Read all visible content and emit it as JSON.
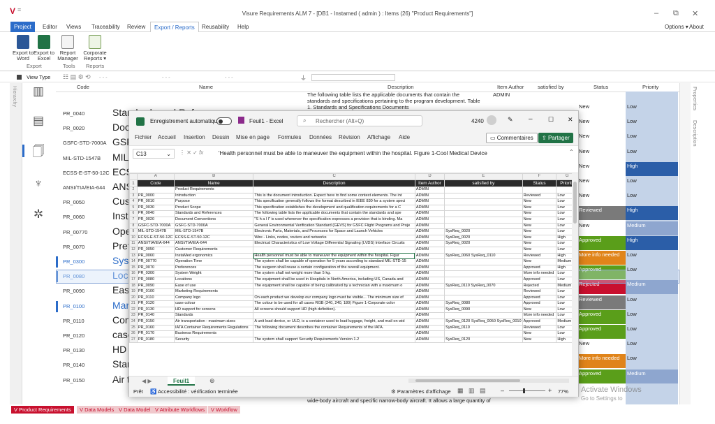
{
  "app": {
    "logo": "V",
    "title": "Visure Requirements ALM 7 - [DB1 - Instamed ( admin ) : Items (26) \"Product Requirements\"]",
    "options": "Options ▾",
    "about": "About"
  },
  "menu": [
    "Project",
    "Editor",
    "Views",
    "Traceability",
    "Review",
    "Export / Reports",
    "Reusability",
    "Help"
  ],
  "ribbon": {
    "export_word": "Export to Word",
    "export_excel": "Export to Excel",
    "report_manager": "Report Manager",
    "corporate_reports": "Corporate Reports ▾",
    "group_export": "Export",
    "group_tools": "Tools",
    "group_reports": "Reports"
  },
  "toolbar2": {
    "view_type": "View Type",
    "dash": "- - -"
  },
  "grid": {
    "headers": {
      "code": "Code",
      "name": "Name",
      "description": "Description",
      "author": "Item Author",
      "satisfied": "satisfied by",
      "status": "Status",
      "priority": "Priority"
    },
    "top_desc": "The following table lists the applicable documents that contain the standards and specifications pertaining to the program development. Table 1. Standards and Specifications Documents",
    "top_author": "ADMIN",
    "bottom_desc": "wide-body aircraft and specific narrow-body aircraft. It allows a large quantity of",
    "rows": [
      {
        "code": "PR_0040",
        "name": "Standards and References",
        "status": "New",
        "priority": "Low",
        "blue": false
      },
      {
        "code": "PR_0020",
        "name": "Doc",
        "status": "New",
        "priority": "Low",
        "blue": false
      },
      {
        "code": "GSFC-STD-7000A",
        "name": "GSFC",
        "status": "New",
        "priority": "Low",
        "blue": false
      },
      {
        "code": "MIL-STD-1547B",
        "name": "MIL-",
        "status": "New",
        "priority": "Low",
        "blue": false
      },
      {
        "code": "ECSS-E-ST-50-12C",
        "name": "ECSS",
        "status": "New",
        "priority": "High",
        "blue": false
      },
      {
        "code": "ANSI/TIA/EIA-644",
        "name": "ANS",
        "status": "New",
        "priority": "Low",
        "blue": false
      },
      {
        "code": "PR_0050",
        "name": "Cus",
        "status": "New",
        "priority": "Low",
        "blue": false
      },
      {
        "code": "PR_0060",
        "name": "Inst",
        "status": "Reviewed",
        "priority": "High",
        "blue": false
      },
      {
        "code": "PR_00770",
        "name": "Ope",
        "status": "New",
        "priority": "Medium",
        "blue": false
      },
      {
        "code": "PR_0070",
        "name": "Pref",
        "status": "Approved",
        "priority": "High",
        "blue": false
      },
      {
        "code": "PR_0300",
        "name": "Syst",
        "status": "More info needed",
        "priority": "Low",
        "blue": true
      },
      {
        "code": "PR_0080",
        "name": "Loca",
        "status": "Approved",
        "priority": "Low",
        "blue": true
      },
      {
        "code": "PR_0090",
        "name": "Ease",
        "status": "Rejected",
        "priority": "Medium",
        "blue": false
      },
      {
        "code": "PR_0100",
        "name": "Mar",
        "status": "Reviewed",
        "priority": "Low",
        "blue": true
      },
      {
        "code": "PR_0110",
        "name": "Con",
        "status": "Approved",
        "priority": "Low",
        "blue": false
      },
      {
        "code": "PR_0120",
        "name": "case",
        "status": "Approved",
        "priority": "Low",
        "blue": false
      },
      {
        "code": "PR_0130",
        "name": "HD",
        "status": "New",
        "priority": "Low",
        "blue": false
      },
      {
        "code": "PR_0140",
        "name": "Star",
        "status": "More info needed",
        "priority": "Low",
        "blue": false
      },
      {
        "code": "PR_0150",
        "name": "Air transportation - maximum sizes",
        "status": "Approved",
        "priority": "Medium",
        "blue": false
      }
    ]
  },
  "right_panels": [
    "Properties",
    "Description"
  ],
  "bottom_tabs": [
    "Product Requirements",
    "Data Models",
    "Data Model",
    "Attribute Workflows",
    "Workflow"
  ],
  "watermark": [
    "Activate Windows",
    "Go to Settings to"
  ],
  "excel": {
    "autosave": "Enregistrement automatique",
    "filename": "Feuil1 - Excel",
    "search": "Rechercher (Alt+Q)",
    "count": "4240",
    "menu": [
      "Fichier",
      "Accueil",
      "Insertion",
      "Dessin",
      "Mise en page",
      "Formules",
      "Données",
      "Révision",
      "Affichage",
      "Aide"
    ],
    "comments": "Commentaires",
    "share": "Partager",
    "cellref": "C13",
    "formula": "'Health personnel must be able to maneuver the equipment within the hospital. Figure 1-Cool Medical Device",
    "columns": [
      "A",
      "B",
      "C",
      "D",
      "E",
      "F",
      "G"
    ],
    "header": [
      "Code",
      "Name",
      "Description",
      "Item Author",
      "satisfied by",
      "Status",
      "Priority"
    ],
    "rows": [
      [
        "2",
        "",
        "Product Requirements",
        "",
        "ADMIN",
        "",
        "",
        ""
      ],
      [
        "3",
        "PR_0000",
        "Introduction",
        "This is the document introduction. Expect here to find some context elements. The int",
        "ADMIN",
        "",
        "Reviewed",
        "Low"
      ],
      [
        "4",
        "PR_0010",
        "Purpose",
        "This specification generally follows the format described in IEEE 830 for a system speci",
        "ADMIN",
        "",
        "New",
        "Low"
      ],
      [
        "5",
        "PR_0030",
        "Product Scope",
        "This specification establishes the development and qualification requirements for a C",
        "ADMIN",
        "",
        "New",
        "Low"
      ],
      [
        "6",
        "PR_0040",
        "Standards and References",
        "The following table lists the applicable documents that contain the standards and spe",
        "ADMIN",
        "",
        "New",
        "Low"
      ],
      [
        "7",
        "PR_0020",
        "Document Conventions",
        "\"S h a l l\" is used whenever the specification expresses a provision that is binding. Ma",
        "ADMIN",
        "",
        "New",
        "Low"
      ],
      [
        "8",
        "GSFC-STD-7000A",
        "GSFC-STD-7000A",
        "General Environmental Verification Standard (GEVS) for GSFC Flight Programs and Proje",
        "ADMIN",
        "",
        "New",
        "Low"
      ],
      [
        "9",
        "MIL-STD-1547B",
        "MIL-STD-1547B",
        "Electronic Parts, Materials, and Processes for Space and Launch Vehicles",
        "ADMIN",
        "SysReq_0020",
        "New",
        "Low"
      ],
      [
        "10",
        "ECSS-E-ST-50-12C",
        "ECSS-E-ST-50-12C",
        "Wire - Links, nodes, routers and networks",
        "ADMIN",
        "SysReq_0020",
        "New",
        "High"
      ],
      [
        "11",
        "ANSI/TIA/EIA-644",
        "ANSI/TIA/EIA-644",
        "Electrical Characteristics of Low Voltage Differential Signaling (LVDS) Interface Circuits",
        "ADMIN",
        "SysReq_0020",
        "New",
        "Low"
      ],
      [
        "12",
        "PR_0050",
        "Customer Requirements",
        "",
        "ADMIN",
        "",
        "New",
        "Low"
      ],
      [
        "13",
        "PR_0060",
        "InstaMed ergonomics",
        "Health personnel must be able to maneuver the equipment within the hospital. Figur",
        "ADMIN",
        "SysReq_0060 SysReq_0110",
        "Reviewed",
        "High"
      ],
      [
        "14",
        "PR_00770",
        "Operation Time",
        "The system shall be capable of operation for 5 years according to standard MIL-STD-15",
        "ADMIN",
        "",
        "New",
        "Medium"
      ],
      [
        "15",
        "PR_0070",
        "Preferences",
        "The surgeon shall reuse a certain configuration of the overall equipment.",
        "ADMIN",
        "",
        "Approved",
        "High"
      ],
      [
        "16",
        "PR_0300",
        "System Weight",
        "The system shall not weight more than 5 kg.",
        "ADMIN",
        "",
        "More info needed",
        "Low"
      ],
      [
        "17",
        "PR_0080",
        "Locations",
        "The equipment shall be used in Hospitals in North America, including US, Canada and",
        "ADMIN",
        "",
        "Approved",
        "Low"
      ],
      [
        "18",
        "PR_0090",
        "Ease of use",
        "The equipment shall be capable of being calibrated by a technician with a maximum o",
        "ADMIN",
        "SysReq_0110 SysReq_0070",
        "Rejected",
        "Medium"
      ],
      [
        "19",
        "PR_0100",
        "Marketing Requirements",
        "",
        "ADMIN",
        "",
        "Reviewed",
        "Low"
      ],
      [
        "20",
        "PR_0110",
        "Company logo",
        "On each product we develop our company logo must be visible... The minimum size of",
        "ADMIN",
        "",
        "Approved",
        "Low"
      ],
      [
        "21",
        "PR_0120",
        "case colour",
        "The colour to be used for all cases RGB (240, 240, 180) Figure 1-Corporate color",
        "ADMIN",
        "SysReq_0080",
        "Approved",
        "Low"
      ],
      [
        "22",
        "PR_0130",
        "HD support for screens",
        "All screens should support HD (high definition).",
        "ADMIN",
        "SysReq_0090",
        "New",
        "Low"
      ],
      [
        "23",
        "PR_0140",
        "Standards",
        "",
        "ADMIN",
        "",
        "More info needed",
        "Low"
      ],
      [
        "24",
        "PR_0150",
        "Air transportation - maximum sizes",
        "A unit load device, or ULD, is a container used to load luggage, freight, and mail on wid",
        "ADMIN",
        "SysReq_0120 SysReq_0050 SysReq_0010",
        "Approved",
        "Medium"
      ],
      [
        "25",
        "PR_0160",
        "IATA Container Requirements Regulations",
        "The following document describes the container Requirements of the IATA.",
        "ADMIN",
        "SysReq_0110",
        "Reviewed",
        "Low"
      ],
      [
        "26",
        "PR_0170",
        "Business Requirements",
        "",
        "ADMIN",
        "",
        "New",
        "Low"
      ],
      [
        "27",
        "PR_0180",
        "Security",
        "The system shall support Security Requirements Version 1.2",
        "ADMIN",
        "SysReq_0120",
        "New",
        "High"
      ]
    ],
    "sheet_tab": "Feuil1",
    "ready": "Prêt",
    "accessibility": "Accessibilité : vérification terminée",
    "display_settings": "Paramètres d'affichage",
    "zoom": "77%"
  },
  "colors": {
    "red": "#c8102e",
    "blue": "#2b6cc9",
    "excel_green": "#217346"
  }
}
